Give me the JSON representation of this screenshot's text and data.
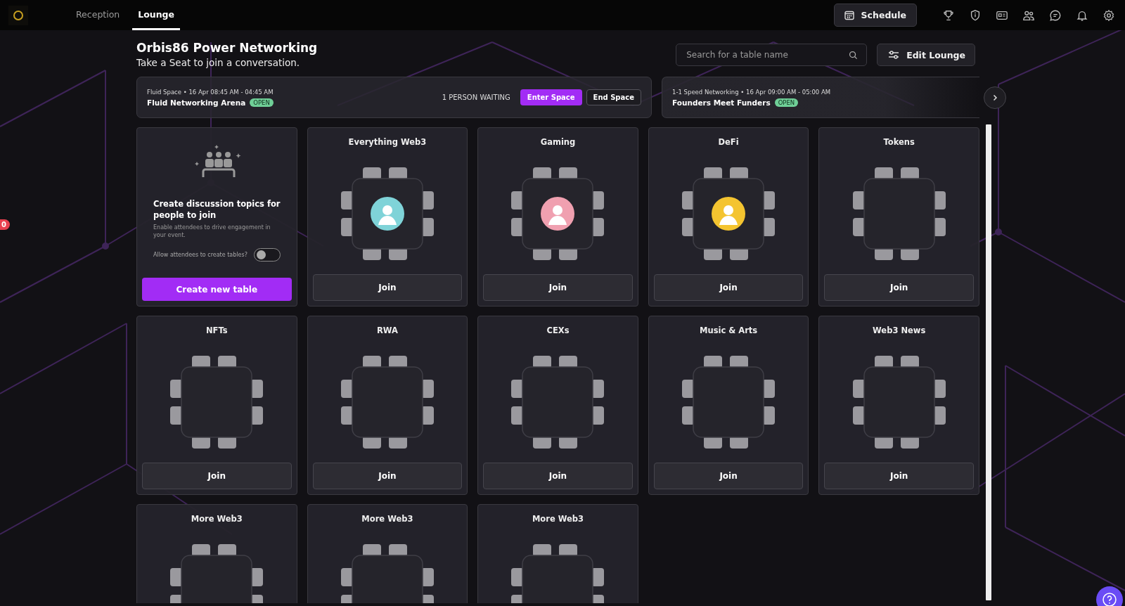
{
  "nav": {
    "tabs": [
      {
        "label": "Reception",
        "selected": false
      },
      {
        "label": "Lounge",
        "selected": true
      }
    ],
    "schedule": "Schedule"
  },
  "header": {
    "title": "Orbis86 Power Networking",
    "subtitle": "Take a Seat to join a conversation.",
    "search": {
      "placeholder": "Search for a table name"
    },
    "edit": "Edit Lounge"
  },
  "side_badge": "0",
  "events": [
    {
      "type": "Fluid Space",
      "time": "• 16 Apr 08:45 AM - 04:45 AM",
      "name": "Fluid Networking Arena",
      "status": "OPEN",
      "waiting": "1 PERSON WAITING",
      "enter": "Enter Space",
      "end": "End Space"
    },
    {
      "type": "1-1 Speed Networking",
      "time": "• 16 Apr 09:00 AM - 05:00 AM",
      "name": "Founders Meet Funders",
      "status": "OPEN"
    }
  ],
  "create": {
    "title": "Create discussion topics for people to join",
    "text": "Enable attendees to drive engagement in your event.",
    "toggle_label": "Allow attendees to create tables?",
    "toggle_on": false,
    "button": "Create new table"
  },
  "tables": [
    {
      "name": "Everything Web3",
      "occupied": true,
      "color": "#7fd3d8",
      "button": "Join"
    },
    {
      "name": "Gaming",
      "occupied": true,
      "color": "#f0a0b0",
      "button": "Join"
    },
    {
      "name": "DeFi",
      "occupied": true,
      "color": "#f4c430",
      "button": "Join"
    },
    {
      "name": "Tokens",
      "occupied": false,
      "button": "Join"
    },
    {
      "name": "NFTs",
      "occupied": false,
      "button": "Join"
    },
    {
      "name": "RWA",
      "occupied": false,
      "button": "Join"
    },
    {
      "name": "CEXs",
      "occupied": false,
      "button": "Join"
    },
    {
      "name": "Music & Arts",
      "occupied": false,
      "button": "Join"
    },
    {
      "name": "Web3 News",
      "occupied": false,
      "button": "Join"
    },
    {
      "name": "More Web3",
      "occupied": false
    },
    {
      "name": "More Web3",
      "occupied": false
    },
    {
      "name": "More Web3",
      "occupied": false
    }
  ]
}
